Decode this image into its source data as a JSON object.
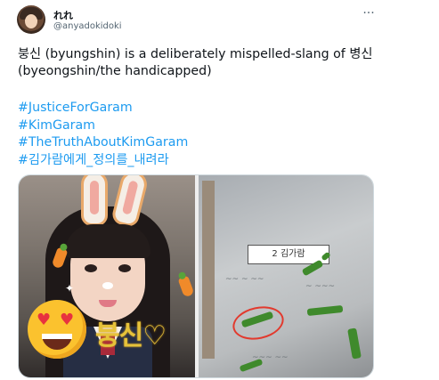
{
  "author": {
    "display_name": "れれ",
    "handle": "@anyadokidoki"
  },
  "menu_glyph": "···",
  "tweet": {
    "text": "붕신 (byungshin) is a deliberately mispelled-slang of 병신 (byeongshin/the handicapped)",
    "hashtags": [
      "#JusticeForGaram",
      "#KimGaram",
      "#TheTruthAboutKimGaram",
      "#김가람에게_정의를_내려라"
    ]
  },
  "media": {
    "left_photo": {
      "overlay_scribble": "붕신♡"
    },
    "right_photo": {
      "desk_tag": "2 김가람"
    }
  },
  "colors": {
    "link": "#1d9bf0",
    "text": "#0f1419",
    "muted": "#536471",
    "border": "#cfd9de"
  }
}
